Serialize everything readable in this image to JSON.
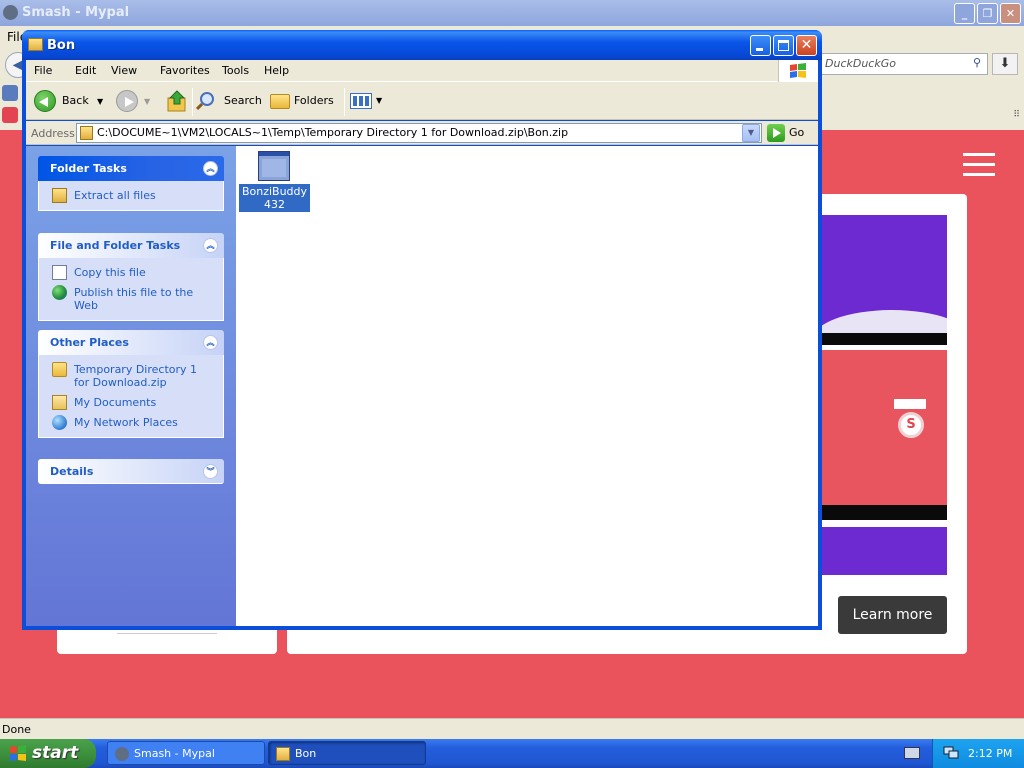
{
  "background_browser": {
    "title": "Smash - Mypal",
    "file_menu": "File",
    "search_placeholder": "DuckDuckGo",
    "learn_more": "Learn more",
    "status": "Done"
  },
  "explorer": {
    "title": "Bon",
    "menu": [
      "File",
      "Edit",
      "View",
      "Favorites",
      "Tools",
      "Help"
    ],
    "toolbar": {
      "back": "Back",
      "search": "Search",
      "folders": "Folders"
    },
    "address": {
      "label": "Address",
      "value": "C:\\DOCUME~1\\VM2\\LOCALS~1\\Temp\\Temporary Directory 1 for Download.zip\\Bon.zip",
      "go": "Go"
    },
    "panels": {
      "folder_tasks": {
        "title": "Folder Tasks",
        "items": [
          "Extract all files"
        ]
      },
      "file_folder_tasks": {
        "title": "File and Folder Tasks",
        "items": [
          "Copy this file",
          "Publish this file to the Web"
        ]
      },
      "other_places": {
        "title": "Other Places",
        "items": [
          "Temporary Directory 1 for Download.zip",
          "My Documents",
          "My Network Places"
        ]
      },
      "details": {
        "title": "Details"
      }
    },
    "files": [
      {
        "name": "BonziBuddy432",
        "selected": true
      }
    ]
  },
  "taskbar": {
    "start": "start",
    "tasks": [
      "Smash - Mypal",
      "Bon"
    ],
    "clock": "2:12 PM"
  },
  "colors": {
    "xp_blue": "#0a4ed9",
    "page_red": "#ea535c",
    "accent_purple": "#6c2ad0",
    "selection": "#316ac5"
  }
}
